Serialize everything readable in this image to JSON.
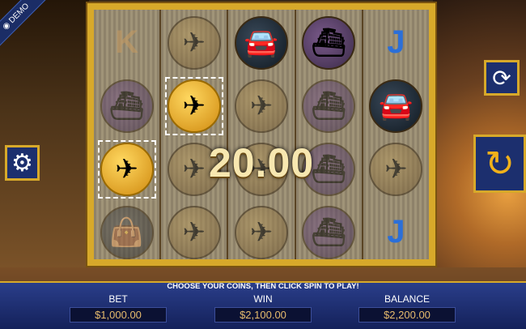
{
  "demo_label": "DEMO",
  "win_amount": "20.00",
  "message": "CHOOSE YOUR COINS, THEN CLICK SPIN TO PLAY!",
  "bet": {
    "label": "BET",
    "value": "$1,000.00"
  },
  "win": {
    "label": "WIN",
    "value": "$2,100.00"
  },
  "balance": {
    "label": "BALANCE",
    "value": "$2,200.00"
  },
  "reels": [
    [
      "K",
      "ship",
      "plane-highlight",
      "bag"
    ],
    [
      "plane",
      "plane-highlight",
      "plane",
      "plane"
    ],
    [
      "car",
      "plane",
      "plane",
      "plane"
    ],
    [
      "ship",
      "ship",
      "ship",
      "ship"
    ],
    [
      "J",
      "car",
      "plane",
      "J"
    ]
  ],
  "colors": {
    "accent": "#d7a92a",
    "panel": "#1c2f6e",
    "value_text": "#e7bb6d"
  }
}
